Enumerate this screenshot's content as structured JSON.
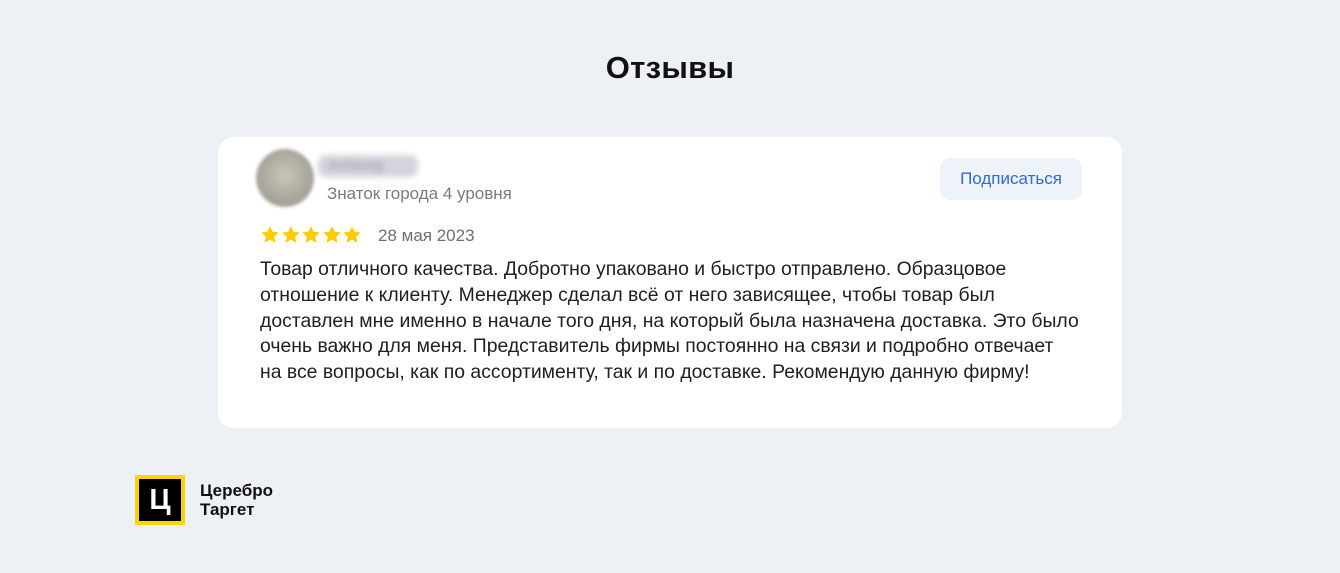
{
  "page": {
    "title": "Отзывы"
  },
  "review": {
    "user": {
      "name": "Achtung",
      "level": "Знаток города 4 уровня"
    },
    "subscribe_label": "Подписаться",
    "rating": 5,
    "rating_max": 5,
    "date": "28 мая 2023",
    "text": "Товар отличного качества. Добротно упаковано и быстро отправлено. Образцовое отношение к клиенту. Менеджер сделал всё от него зависящее, чтобы товар был доставлен мне именно в начале того дня, на который была назначена доставка. Это было очень важно для меня. Представитель фирмы постоянно на связи и подробно отвечает на все вопросы, как по ассортименту, так и по доставке. Рекомендую данную фирму!"
  },
  "brand": {
    "logo_letter": "Ц",
    "line1": "Церебро",
    "line2": "Таргет"
  },
  "colors": {
    "background": "#edf0f5",
    "card": "#ffffff",
    "accent_blue": "#2a6be2",
    "star": "#fccc00",
    "brand_yellow": "#ffd400"
  },
  "icons": {
    "star": "star-icon",
    "avatar": "avatar"
  }
}
